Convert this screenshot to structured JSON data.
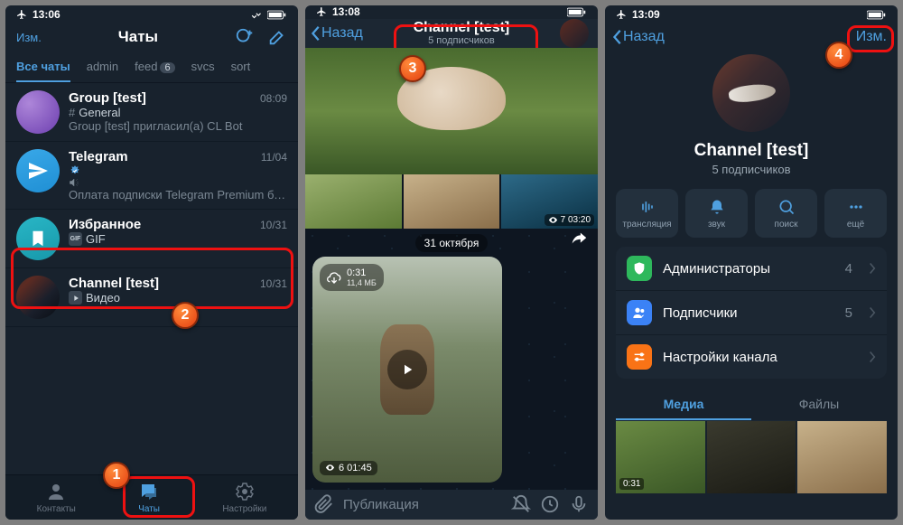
{
  "phone1": {
    "status_time": "13:06",
    "edit_btn": "Изм.",
    "title": "Чаты",
    "folders": [
      {
        "label": "Все чаты",
        "active": true
      },
      {
        "label": "admin"
      },
      {
        "label": "feed",
        "badge": "6"
      },
      {
        "label": "svcs"
      },
      {
        "label": "sort"
      }
    ],
    "chats": [
      {
        "name": "Group [test]",
        "time": "08:09",
        "sub1_prefix": "#",
        "sub1": "General",
        "sub2": "Group [test] пригласил(а) CL Bot",
        "avatar": "purple"
      },
      {
        "name": "Telegram",
        "verified": true,
        "muted": true,
        "time": "11/04",
        "sub2": "Оплата подписки Telegram Premium банковскими картами РФ через плате…",
        "avatar": "blue"
      },
      {
        "name": "Избранное",
        "time": "10/31",
        "sub1_icon": "gif",
        "sub1": "GIF",
        "avatar": "teal"
      },
      {
        "name": "Channel [test]",
        "time": "10/31",
        "sub1_icon": "video",
        "sub1": "Видео",
        "avatar": "img",
        "highlight": true
      }
    ],
    "tabs": [
      {
        "label": "Контакты",
        "icon": "contact"
      },
      {
        "label": "Чаты",
        "icon": "chats",
        "active": true
      },
      {
        "label": "Настройки",
        "icon": "settings"
      }
    ]
  },
  "phone2": {
    "status_time": "13:08",
    "back": "Назад",
    "title": "Channel [test]",
    "subtitle": "5 подписчиков",
    "thumb3_views": "7 03:20",
    "date_separator": "31 октября",
    "video_pill_time": "0:31",
    "video_pill_size": "11,4 МБ",
    "video_bottom_views": "6 01:45",
    "composer_placeholder": "Публикация"
  },
  "phone3": {
    "status_time": "13:09",
    "back": "Назад",
    "edit": "Изм.",
    "title": "Channel [test]",
    "subtitle": "5 подписчиков",
    "buttons": [
      {
        "label": "трансляция",
        "icon": "stream"
      },
      {
        "label": "звук",
        "icon": "bell"
      },
      {
        "label": "поиск",
        "icon": "search"
      },
      {
        "label": "ещё",
        "icon": "more"
      }
    ],
    "rows": [
      {
        "label": "Администраторы",
        "value": "4",
        "icon": "shield",
        "cls": "green"
      },
      {
        "label": "Подписчики",
        "value": "5",
        "icon": "users",
        "cls": "blue"
      },
      {
        "label": "Настройки канала",
        "icon": "sliders",
        "cls": "orange"
      }
    ],
    "media_tabs": [
      {
        "label": "Медиа",
        "active": true
      },
      {
        "label": "Файлы"
      }
    ],
    "media_cells": [
      {
        "dur": "0:31"
      },
      {
        "dur": ""
      },
      {
        "dur": ""
      }
    ]
  }
}
